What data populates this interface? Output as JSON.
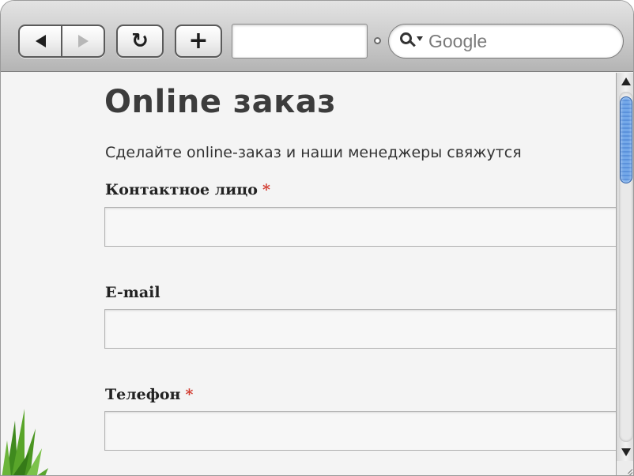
{
  "toolbar": {
    "back_icon": "back-arrow-icon",
    "forward_icon": "forward-arrow-icon",
    "reload_glyph": "↻",
    "reload_icon": "reload-icon",
    "add_glyph": "+",
    "add_icon": "plus-icon",
    "address_value": "",
    "search_placeholder": "Google",
    "search_icon": "search-icon"
  },
  "page": {
    "title": "Online заказ",
    "subtitle": "Сделайте online-заказ и наши менеджеры свяжутся"
  },
  "form": {
    "fields": [
      {
        "label": "Контактное лицо",
        "required_mark": "*",
        "value": ""
      },
      {
        "label": "E-mail",
        "required_mark": "",
        "value": ""
      },
      {
        "label": "Телефон",
        "required_mark": "*",
        "value": ""
      }
    ]
  },
  "colors": {
    "required": "#d23b2f",
    "scroll_thumb": "#6aa0e4"
  }
}
